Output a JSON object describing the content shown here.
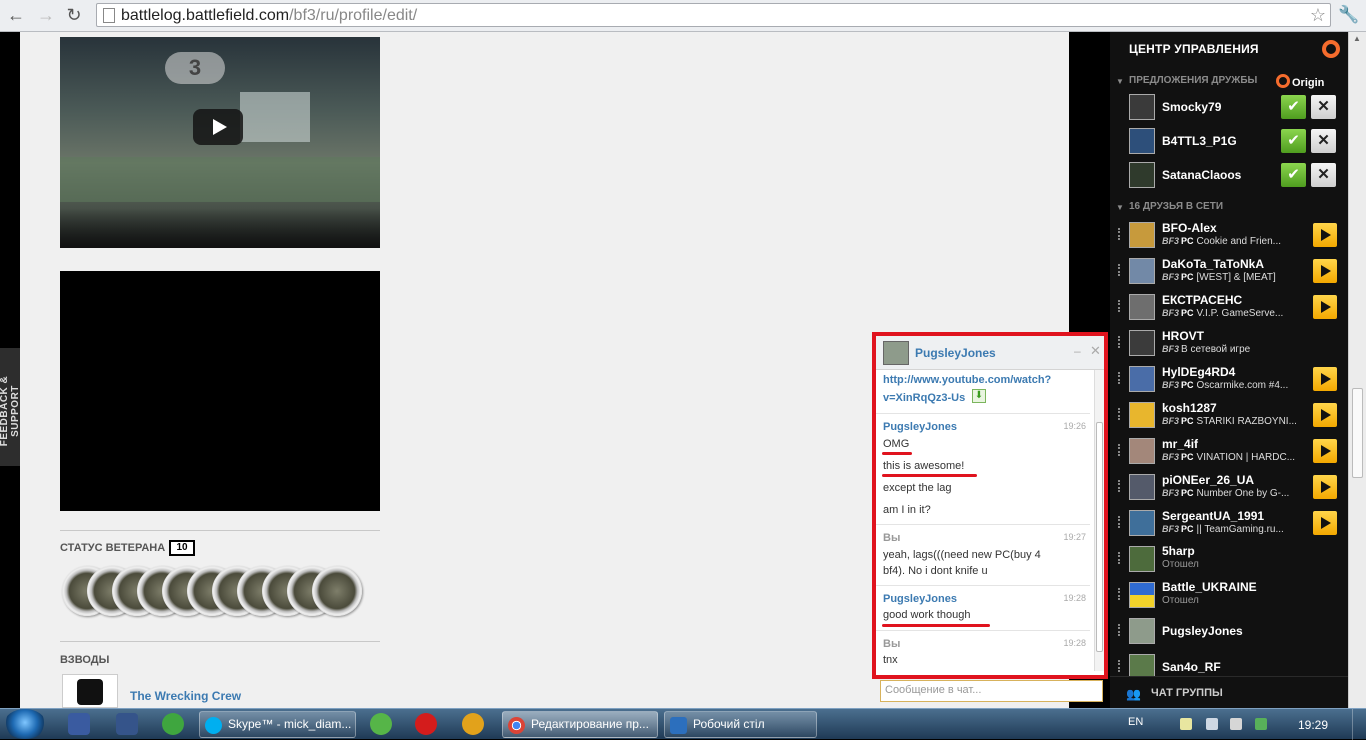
{
  "browser": {
    "url_host": "battlelog.battlefield.com",
    "url_path": "/bf3/ru/profile/edit/"
  },
  "feedback_tab": "FEEDBACK & SUPPORT",
  "profile": {
    "veteran_label": "СТАТУС ВЕТЕРАНА",
    "veteran_value": "10",
    "platoons_label": "ВЗВОДЫ",
    "platoon_name": "The Wrecking Crew"
  },
  "chat": {
    "title": "PugsleyJones",
    "link_line1": "http://www.youtube.com/watch?",
    "link_line2": "v=XinRqQz3-Us",
    "messages": [
      {
        "sender": "PugsleyJones",
        "time": "19:26",
        "lines": [
          "OMG",
          "this is awesome!",
          "except the lag",
          "am I in it?"
        ]
      },
      {
        "sender": "Вы",
        "time": "19:27",
        "lines": [
          "yeah, lags(((need new PC(buy 4",
          "bf4). No i dont knife u"
        ]
      },
      {
        "sender": "PugsleyJones",
        "time": "19:28",
        "lines": [
          "good work though"
        ]
      },
      {
        "sender": "Вы",
        "time": "19:28",
        "lines": [
          "tnx"
        ]
      }
    ],
    "input_placeholder": "Сообщение в чат..."
  },
  "side_panel": {
    "title": "ЦЕНТР УПРАВЛЕНИЯ",
    "requests_label": "ПРЕДЛОЖЕНИЯ ДРУЖБЫ",
    "origin_label": "Origin",
    "requests": [
      {
        "name": "Smocky79"
      },
      {
        "name": "B4TTL3_P1G"
      },
      {
        "name": "SatanaClaoos"
      }
    ],
    "online_label": "16 ДРУЗЬЯ В СЕТИ",
    "game_tag": "BF3",
    "platform_tag": "PC",
    "friends": [
      {
        "name": "BFO-Alex",
        "status": "Cookie and Frien...",
        "joinable": true
      },
      {
        "name": "DaKoTa_TaToNkA",
        "status": "[WEST] & [MEAT]",
        "joinable": true
      },
      {
        "name": "ЕКСТРАСЕНС",
        "status": "V.I.P. GameServe...",
        "joinable": true
      },
      {
        "name": "HROVT",
        "status": "В сетевой игре",
        "joinable": false
      },
      {
        "name": "HylDEg4RD4",
        "status": "Oscarmike.com #4...",
        "joinable": true
      },
      {
        "name": "kosh1287",
        "status": "STARIKI RAZBOYNI...",
        "joinable": true
      },
      {
        "name": "mr_4if",
        "status": "VINATION | HARDC...",
        "joinable": true
      },
      {
        "name": "piONEer_26_UA",
        "status": "Number One by G-...",
        "joinable": true
      },
      {
        "name": "SergeantUA_1991",
        "status": "|| TeamGaming.ru...",
        "joinable": true
      },
      {
        "name": "5harp",
        "status": "Отошел",
        "joinable": false
      },
      {
        "name": "Battle_UKRAINE",
        "status": "Отошел",
        "joinable": false
      },
      {
        "name": "PugsleyJones",
        "status": "",
        "joinable": false
      },
      {
        "name": "San4o_RF",
        "status": "",
        "joinable": false
      }
    ],
    "group_chat_label": "ЧАТ ГРУППЫ"
  },
  "taskbar": {
    "skype_label": "Skype™ - mick_diam...",
    "chrome_label": "Редактирование пр...",
    "desktop_label": "Робочий стіл",
    "language": "EN",
    "clock": "19:29"
  },
  "colors": {
    "accent_red": "#e0131e",
    "link_blue": "#3c7ab1",
    "origin_orange": "#f56c2d",
    "accept_green": "#5fae28",
    "join_yellow": "#f3b400"
  }
}
